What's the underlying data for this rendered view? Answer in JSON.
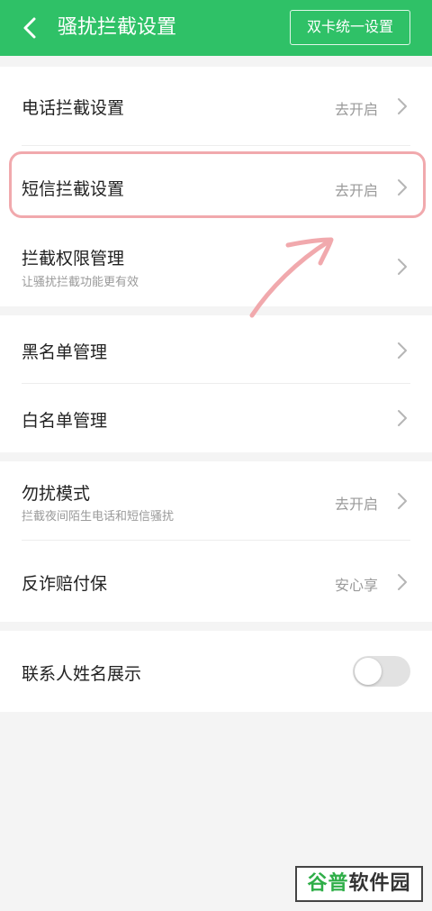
{
  "header": {
    "title": "骚扰拦截设置",
    "dual_sim_button": "双卡统一设置",
    "back_icon": "chevron-left-icon"
  },
  "section1": {
    "call_block": {
      "title": "电话拦截设置",
      "status": "去开启"
    },
    "sms_block": {
      "title": "短信拦截设置",
      "status": "去开启"
    },
    "permission": {
      "title": "拦截权限管理",
      "subtitle": "让骚扰拦截功能更有效"
    }
  },
  "section2": {
    "blacklist": {
      "title": "黑名单管理"
    },
    "whitelist": {
      "title": "白名单管理"
    }
  },
  "section3": {
    "dnd": {
      "title": "勿扰模式",
      "subtitle": "拦截夜间陌生电话和短信骚扰",
      "status": "去开启"
    },
    "fraud": {
      "title": "反诈赔付保",
      "status": "安心享"
    }
  },
  "section4": {
    "contact_name": {
      "title": "联系人姓名展示",
      "toggle_on": false
    }
  },
  "watermark": {
    "part1": "谷普",
    "part2": "软件园"
  },
  "colors": {
    "header_bg": "#2fc167",
    "highlight": "#f1a9ad",
    "background": "#f4f4f4"
  }
}
